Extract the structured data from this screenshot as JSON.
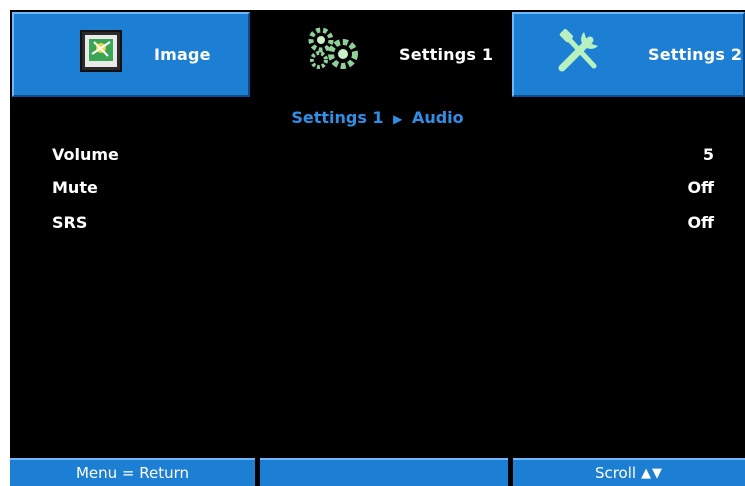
{
  "tabs": [
    {
      "label": "Image",
      "icon": "image-icon",
      "active": false
    },
    {
      "label": "Settings 1",
      "icon": "gears-icon",
      "active": true
    },
    {
      "label": "Settings 2",
      "icon": "tools-icon",
      "active": false
    }
  ],
  "breadcrumb": {
    "parent": "Settings 1",
    "separator": "▶",
    "current": "Audio"
  },
  "menu": {
    "items": [
      {
        "label": "Volume",
        "value": "5"
      },
      {
        "label": "Mute",
        "value": "Off"
      },
      {
        "label": "SRS",
        "value": "Off"
      }
    ]
  },
  "footer": {
    "left": "Menu = Return",
    "middle": "",
    "right": "Scroll",
    "right_arrows": "▲▼"
  },
  "colors": {
    "tab_blue": "#1d7fd3",
    "breadcrumb_blue": "#2f8fe6",
    "background": "#000000"
  }
}
